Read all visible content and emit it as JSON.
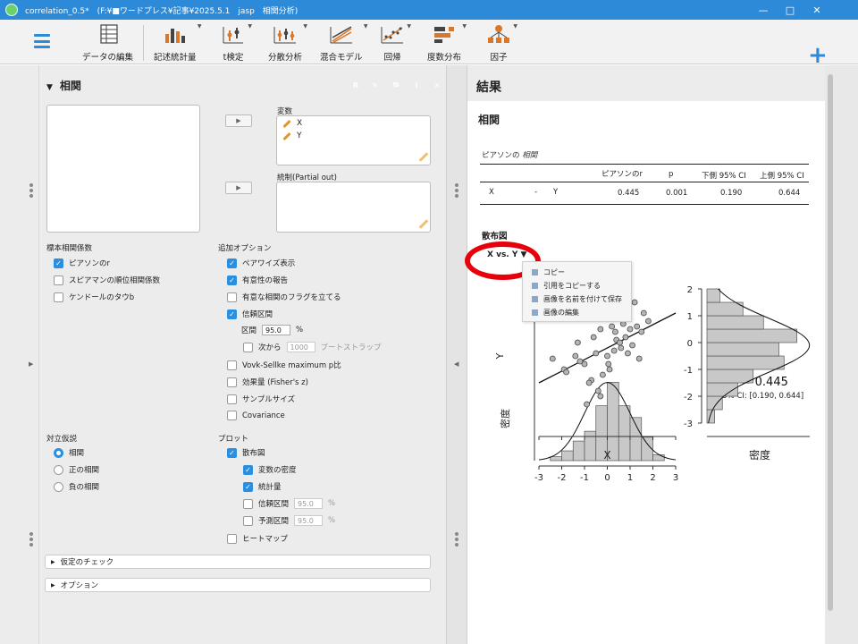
{
  "window": {
    "title": "correlation_0.5*　(F:¥■ワードプレス¥記事¥2025.5.1　jasp　相関分析)",
    "minimize": "—",
    "maximize": "□",
    "close": "✕"
  },
  "toolbar": {
    "items": [
      {
        "label": "データの編集",
        "icon": "spreadsheet-icon"
      },
      {
        "label": "記述統計量",
        "icon": "descriptives-icon"
      },
      {
        "label": "t検定",
        "icon": "ttest-icon"
      },
      {
        "label": "分散分析",
        "icon": "anova-icon"
      },
      {
        "label": "混合モデル",
        "icon": "mixed-model-icon"
      },
      {
        "label": "回帰",
        "icon": "regression-icon"
      },
      {
        "label": "度数分布",
        "icon": "frequencies-icon"
      },
      {
        "label": "因子",
        "icon": "factor-icon"
      }
    ],
    "add": "+"
  },
  "options": {
    "title": "相関",
    "header_icons": [
      {
        "glyph": "R",
        "color": "#1f5fb8",
        "name": "r-syntax-icon"
      },
      {
        "glyph": "✎",
        "color": "#111111",
        "name": "edit-title-icon"
      },
      {
        "glyph": "⧉",
        "color": "#2aa84a",
        "name": "duplicate-icon"
      },
      {
        "glyph": "i",
        "color": "#3a86d8",
        "name": "info-icon"
      },
      {
        "glyph": "✕",
        "color": "#e03a3a",
        "name": "close-analysis-icon"
      }
    ],
    "move_glyph": "▶",
    "variables_label": "変数",
    "variables": [
      "X",
      "Y"
    ],
    "partial_label": "統制(Partial out)",
    "coef_label": "標本相関係数",
    "coef": [
      {
        "label": "ピアソンのr",
        "checked": true
      },
      {
        "label": "スピアマンの順位相関係数",
        "checked": false
      },
      {
        "label": "ケンドールのタウb",
        "checked": false
      }
    ],
    "extra_label": "追加オプション",
    "extra": [
      {
        "label": "ペアワイズ表示",
        "checked": true
      },
      {
        "label": "有意性の報告",
        "checked": true
      },
      {
        "label": "有意な相関のフラグを立てる",
        "checked": false
      },
      {
        "label": "信頼区間",
        "checked": true
      }
    ],
    "interval_label": "区間",
    "interval_value": "95.0",
    "interval_unit": "%",
    "from_label": "次から",
    "from_value": "1000",
    "bootstrap_label": "ブートストラップ",
    "extra2": [
      {
        "label": "Vovk-Sellke maximum p比",
        "checked": false
      },
      {
        "label": "効果量 (Fisher's z)",
        "checked": false
      },
      {
        "label": "サンプルサイズ",
        "checked": false
      },
      {
        "label": "Covariance",
        "checked": false
      }
    ],
    "alt_label": "対立仮説",
    "alt": [
      {
        "label": "相関",
        "checked": true
      },
      {
        "label": "正の相関",
        "checked": false
      },
      {
        "label": "負の相関",
        "checked": false
      }
    ],
    "plot_label": "プロット",
    "plots": {
      "scatter": "散布図",
      "density": "変数の密度",
      "stats": "統計量",
      "ci": "信頼区間",
      "ci_value": "95.0",
      "pi": "予測区間",
      "pi_value": "95.0",
      "pct": "%",
      "heatmap": "ヒートマップ"
    },
    "assumption": "仮定のチェック",
    "optionsSection": "オプション"
  },
  "results": {
    "title": "結果",
    "subtitle": "相関",
    "table": {
      "title_pre": "ピアソンの ",
      "title_em": "相関",
      "headers": [
        "ピアソンのr",
        "p",
        "下側 95% CI",
        "上側 95% CI"
      ],
      "row": {
        "v1": "X",
        "dash": "-",
        "v2": "Y",
        "r": "0.445",
        "p": "0.001",
        "lower": "0.190",
        "upper": "0.644"
      }
    },
    "plot_title": "散布図",
    "plot_menu_label": "X vs. Y",
    "menu_items": [
      "コピー",
      "引用をコピーする",
      "画像を名前を付けて保存",
      "画像の編集"
    ]
  },
  "chart_data": {
    "type": "scatter",
    "xlabel": "X",
    "ylabel": "Y",
    "top_ylabel": "密度",
    "right_xlabel": "密度",
    "stat_r": "r = 0.445",
    "stat_ci": "95% CI: [0.190, 0.644]",
    "x_ticks": [
      -3,
      -2,
      -1,
      0,
      1,
      2,
      3
    ],
    "y_ticks": [
      2,
      1,
      0,
      -1,
      -2,
      -3
    ],
    "xlim": [
      -3,
      3
    ],
    "ylim": [
      -3,
      2
    ],
    "regression": {
      "x": [
        -3,
        3
      ],
      "y": [
        -1.5,
        1.1
      ]
    },
    "points": [
      {
        "x": -2.4,
        "y": -0.6
      },
      {
        "x": -1.9,
        "y": -1.0
      },
      {
        "x": -1.8,
        "y": -1.1
      },
      {
        "x": -1.4,
        "y": -0.5
      },
      {
        "x": -1.2,
        "y": -0.7
      },
      {
        "x": -1.0,
        "y": -0.8
      },
      {
        "x": -0.9,
        "y": -2.3
      },
      {
        "x": -0.7,
        "y": -1.4
      },
      {
        "x": -0.6,
        "y": 0.2
      },
      {
        "x": -0.5,
        "y": -0.4
      },
      {
        "x": -0.4,
        "y": -1.8
      },
      {
        "x": -0.3,
        "y": 0.5
      },
      {
        "x": -0.2,
        "y": -1.2
      },
      {
        "x": -0.1,
        "y": 0.9
      },
      {
        "x": 0.0,
        "y": -0.5
      },
      {
        "x": 0.1,
        "y": -1.0
      },
      {
        "x": 0.15,
        "y": 1.3
      },
      {
        "x": 0.2,
        "y": 0.6
      },
      {
        "x": 0.3,
        "y": -0.3
      },
      {
        "x": 0.35,
        "y": 0.4
      },
      {
        "x": 0.4,
        "y": 0.1
      },
      {
        "x": 0.5,
        "y": 1.0
      },
      {
        "x": 0.6,
        "y": -0.2
      },
      {
        "x": 0.7,
        "y": 0.7
      },
      {
        "x": 0.8,
        "y": 0.2
      },
      {
        "x": 0.9,
        "y": -0.4
      },
      {
        "x": 1.0,
        "y": 0.5
      },
      {
        "x": 1.1,
        "y": -0.1
      },
      {
        "x": 1.2,
        "y": 1.5
      },
      {
        "x": 1.3,
        "y": 0.6
      },
      {
        "x": 1.4,
        "y": -0.6
      },
      {
        "x": 1.5,
        "y": 0.4
      },
      {
        "x": 1.6,
        "y": 1.1
      },
      {
        "x": -0.8,
        "y": -1.5
      },
      {
        "x": -0.3,
        "y": -2.0
      },
      {
        "x": 0.25,
        "y": 1.8
      },
      {
        "x": -1.3,
        "y": 0.0
      },
      {
        "x": 0.05,
        "y": -0.8
      },
      {
        "x": 0.55,
        "y": 0.0
      },
      {
        "x": 1.8,
        "y": 0.8
      }
    ],
    "x_hist": {
      "bins": [
        -2.5,
        -2,
        -1.5,
        -1,
        -0.5,
        0,
        0.5,
        1,
        1.5,
        2,
        2.5
      ],
      "density": [
        0.02,
        0.05,
        0.1,
        0.15,
        0.28,
        0.4,
        0.28,
        0.22,
        0.12,
        0.03
      ]
    },
    "y_hist": {
      "bins": [
        -3,
        -2.5,
        -2,
        -1.5,
        -1,
        -0.5,
        0,
        0.5,
        1,
        1.5,
        2
      ],
      "density": [
        0.03,
        0.06,
        0.12,
        0.18,
        0.3,
        0.28,
        0.35,
        0.22,
        0.14,
        0.05
      ]
    }
  },
  "colors": {
    "accent": "#2a8fe0",
    "highlight": "#e8000b",
    "toolbar_icon": "#d9782a"
  }
}
